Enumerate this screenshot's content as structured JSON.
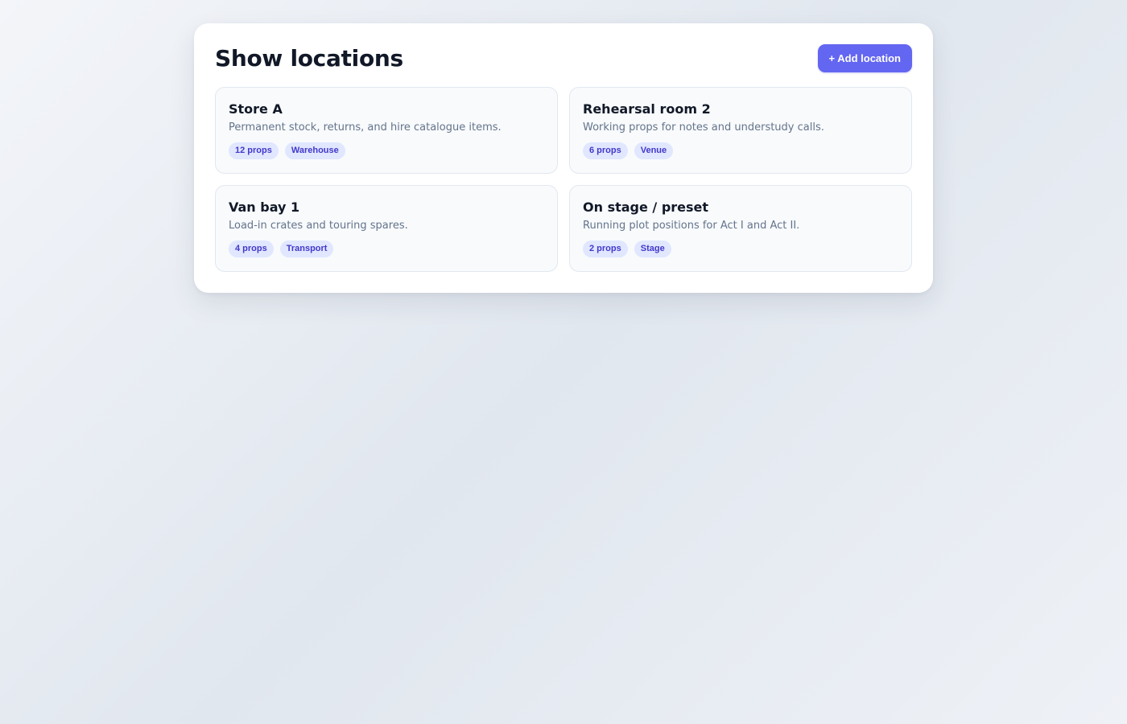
{
  "header": {
    "title": "Show locations",
    "add_button_label": "+ Add location"
  },
  "theme": {
    "accent": "#6366f1",
    "tag_bg": "#e0e7ff",
    "tag_text": "#4338ca"
  },
  "locations": [
    {
      "name": "Store A",
      "description": "Permanent stock, returns, and hire catalogue items.",
      "count": "12 props",
      "category": "Warehouse"
    },
    {
      "name": "Rehearsal room 2",
      "description": "Working props for notes and understudy calls.",
      "count": "6 props",
      "category": "Venue"
    },
    {
      "name": "Van bay 1",
      "description": "Load-in crates and touring spares.",
      "count": "4 props",
      "category": "Transport"
    },
    {
      "name": "On stage / preset",
      "description": "Running plot positions for Act I and Act II.",
      "count": "2 props",
      "category": "Stage"
    }
  ]
}
